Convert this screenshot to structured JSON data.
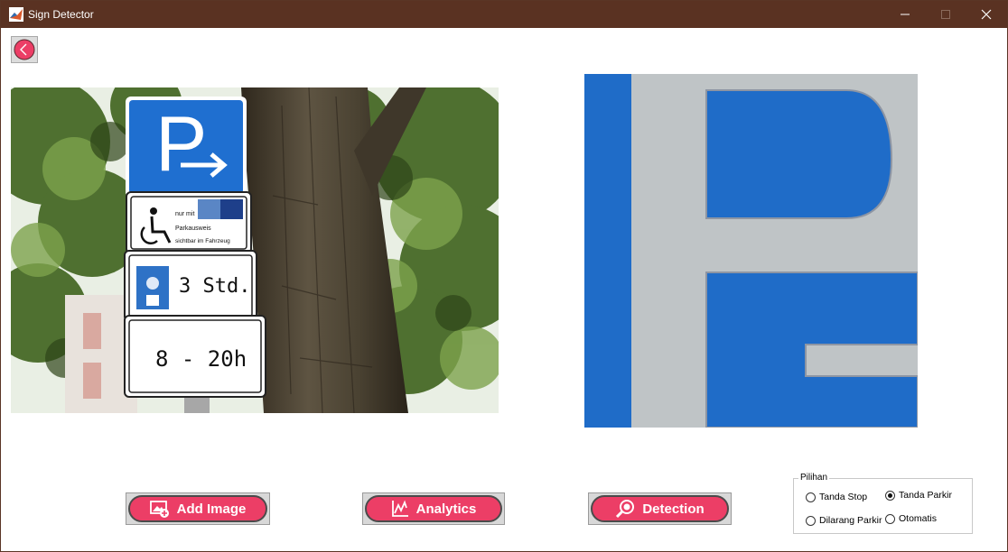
{
  "window": {
    "title": "Sign Detector"
  },
  "colors": {
    "titlebar": "#5a3222",
    "accent": "#ec3e66",
    "sign_blue": "#1f6fd0"
  },
  "toolbar": {
    "back_icon": "chevron-left-icon"
  },
  "photo_sign": {
    "plate_line1": "nur mit",
    "plate_line2": "Parkausweis",
    "plate_line3": "sichtbar im Fahrzeug",
    "time_limit": "3 Std.",
    "hours": "8 - 20h",
    "parking_letter": "P"
  },
  "buttons": {
    "add_image": "Add Image",
    "analytics": "Analytics",
    "detection": "Detection"
  },
  "options": {
    "group_label": "Pilihan",
    "items": [
      {
        "label": "Tanda Stop",
        "selected": false
      },
      {
        "label": "Tanda Parkir",
        "selected": true
      },
      {
        "label": "Dilarang Parkir",
        "selected": false
      },
      {
        "label": "Otomatis",
        "selected": false
      }
    ]
  }
}
